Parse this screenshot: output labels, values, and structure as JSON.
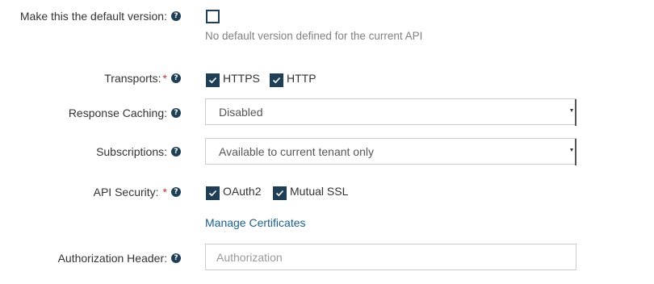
{
  "default_version": {
    "label": "Make this the default version:",
    "checked": false,
    "hint": "No default version defined for the current API"
  },
  "transports": {
    "label": "Transports:",
    "required_mark": "*",
    "options": [
      {
        "label": "HTTPS",
        "checked": true
      },
      {
        "label": "HTTP",
        "checked": true
      }
    ]
  },
  "response_caching": {
    "label": "Response Caching:",
    "selected": "Disabled"
  },
  "subscriptions": {
    "label": "Subscriptions:",
    "selected": "Available to current tenant only"
  },
  "api_security": {
    "label": "API Security:",
    "required_mark": "*",
    "options": [
      {
        "label": "OAuth2",
        "checked": true
      },
      {
        "label": "Mutual SSL",
        "checked": true
      }
    ],
    "manage_link": "Manage Certificates"
  },
  "authorization_header": {
    "label": "Authorization Header:",
    "value": "",
    "placeholder": "Authorization"
  },
  "icons": {
    "help": "help-icon",
    "check": "check-icon"
  },
  "colors": {
    "accent": "#1f3f57",
    "link": "#1a5f8a",
    "required": "#c0392b"
  }
}
